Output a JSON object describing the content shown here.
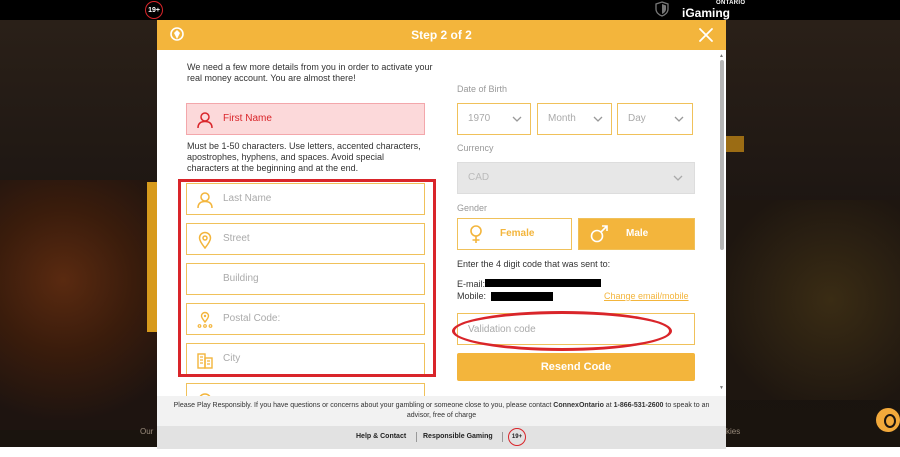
{
  "topbar": {
    "age_badge": "19+",
    "igaming_logo": "iGaming",
    "igaming_sub": "ONTARIO"
  },
  "background": {
    "left_text": "Our",
    "right_text": "kies"
  },
  "modal": {
    "title": "Step 2 of 2",
    "intro": "We need a few more details from you in order to activate your real money account. You are almost there!",
    "first_name_label": "First Name",
    "first_name_hint": "Must be 1-50 characters. Use letters, accented characters, apostrophes, hyphens, and spaces. Avoid special characters at the beginning and at the end.",
    "last_name_label": "Last Name",
    "street_label": "Street",
    "building_label": "Building",
    "postal_label": "Postal Code:",
    "city_label": "City",
    "dob_label": "Date of Birth",
    "dob_year": "1970",
    "dob_month": "Month",
    "dob_day": "Day",
    "currency_label": "Currency",
    "currency_value": "CAD",
    "gender_label": "Gender",
    "gender_female": "Female",
    "gender_male": "Male",
    "code_sent_text": "Enter the 4 digit code that was sent to:",
    "email_label": "E-mail:",
    "mobile_label": "Mobile:",
    "change_link": "Change email/mobile",
    "validation_placeholder": "Validation code",
    "resend_button": "Resend Code"
  },
  "footer": {
    "notice_prefix": "Please Play Responsibly. If you have questions or concerns about your gambling or someone close to you, please contact",
    "contact_name": "ConnexOntario",
    "notice_mid": "at",
    "phone": "1-866-531-2600",
    "notice_suffix": "to speak to an advisor, free of charge",
    "help_contact": "Help & Contact",
    "responsible_gaming": "Responsible Gaming",
    "age_badge": "19+"
  },
  "colors": {
    "accent": "#f3b53c",
    "error": "#d9252a",
    "error_bg": "#fcd9da"
  }
}
